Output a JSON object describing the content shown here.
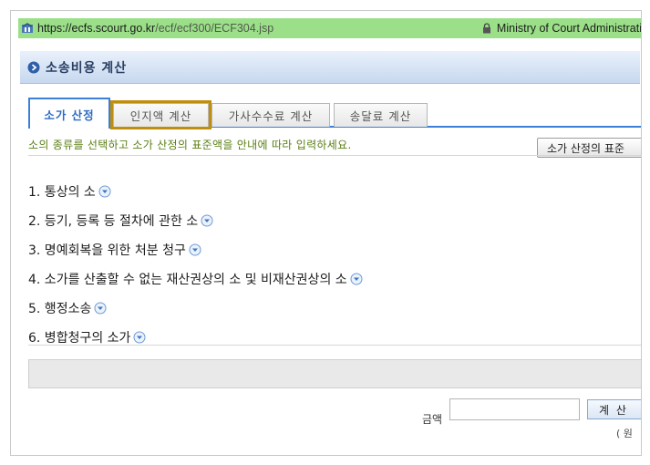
{
  "address_bar": {
    "url_host": "https://ecfs.scourt.go.kr",
    "url_path": "/ecf/ecf300/ECF304.jsp",
    "cert_owner": "Ministry of Court Administrati",
    "icon": "site-favicon-icon",
    "lock_icon": "lock-icon"
  },
  "page": {
    "title": "소송비용 계산",
    "title_icon": "circle-arrow-icon"
  },
  "tabs": [
    {
      "label": "소가 산정",
      "active": true
    },
    {
      "label": "인지액 계산",
      "active": false,
      "highlighted": true
    },
    {
      "label": "가사수수료 계산",
      "active": false
    },
    {
      "label": "송달료 계산",
      "active": false
    }
  ],
  "guide_text": "소의 종류를 선택하고 소가 산정의 표준액을 안내에 따라 입력하세요.",
  "standard_button_label": "소가 산정의 표준",
  "categories": [
    {
      "label": "1. 통상의 소"
    },
    {
      "label": "2. 등기, 등록 등 절차에 관한 소"
    },
    {
      "label": "3. 명예회복을 위한 처분 청구"
    },
    {
      "label": "4. 소가를 산출할 수 없는 재산권상의 소 및 비재산권상의 소"
    },
    {
      "label": "5. 행정소송"
    },
    {
      "label": "6. 병합청구의 소가"
    }
  ],
  "amount": {
    "label": "금액",
    "value": "",
    "calc_button_label": "계 산",
    "note": "( 원"
  },
  "colors": {
    "address_bar_bg": "#9be089",
    "tab_accent": "#3c7fd8",
    "highlight_outline": "#c08e0e",
    "guide_text": "#5b7f14"
  }
}
